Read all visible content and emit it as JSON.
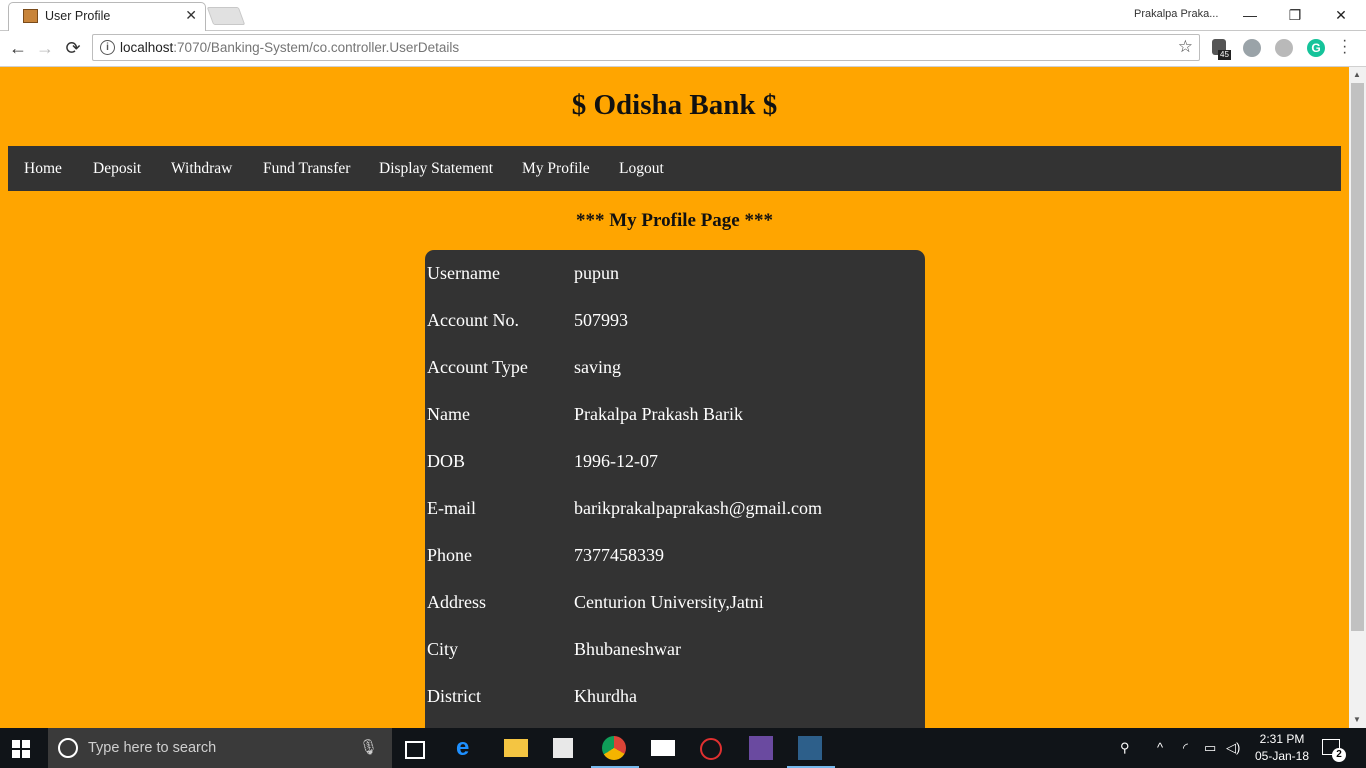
{
  "browser": {
    "tab_title": "User Profile",
    "tab_close": "✕",
    "profile_name": "Prakalpa Praka...",
    "url_host": "localhost",
    "url_rest": ":7070/Banking-System/co.controller.UserDetails",
    "extension_badge": "45",
    "window_controls": {
      "minimize": "—",
      "restore": "❐",
      "close": "✕"
    },
    "nav": {
      "back": "←",
      "forward": "→",
      "reload": "⟳"
    }
  },
  "site": {
    "title": "$ Odisha Bank $",
    "nav": [
      "Home",
      "Deposit",
      "Withdraw",
      "Fund Transfer",
      "Display Statement",
      "My Profile",
      "Logout"
    ],
    "page_heading": "*** My Profile Page ***"
  },
  "profile": [
    {
      "label": "Username",
      "value": "pupun"
    },
    {
      "label": "Account No.",
      "value": "507993"
    },
    {
      "label": "Account Type",
      "value": "saving"
    },
    {
      "label": "Name",
      "value": "Prakalpa Prakash Barik"
    },
    {
      "label": "DOB",
      "value": "1996-12-07"
    },
    {
      "label": "E-mail",
      "value": "barikprakalpaprakash@gmail.com"
    },
    {
      "label": "Phone",
      "value": "7377458339"
    },
    {
      "label": "Address",
      "value": "Centurion University,Jatni"
    },
    {
      "label": "City",
      "value": "Bhubaneshwar"
    },
    {
      "label": "District",
      "value": "Khurdha"
    }
  ],
  "taskbar": {
    "search_placeholder": "Type here to search",
    "time": "2:31 PM",
    "date": "05-Jan-18",
    "notification_count": "2"
  },
  "colors": {
    "page_bg": "#ffa500",
    "nav_bg": "#333333",
    "card_bg": "#333333"
  }
}
